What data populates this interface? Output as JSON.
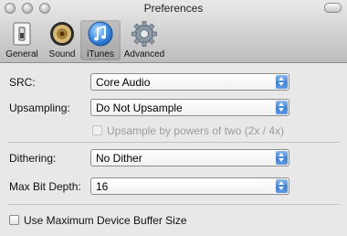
{
  "window": {
    "title": "Preferences"
  },
  "toolbar": {
    "items": [
      {
        "label": "General",
        "icon": "toggle-switch-icon"
      },
      {
        "label": "Sound",
        "icon": "speaker-icon"
      },
      {
        "label": "iTunes",
        "icon": "itunes-icon",
        "selected": true
      },
      {
        "label": "Advanced",
        "icon": "gear-icon"
      }
    ]
  },
  "form": {
    "src": {
      "label": "SRC:",
      "value": "Core Audio"
    },
    "upsampling": {
      "label": "Upsampling:",
      "value": "Do Not Upsample"
    },
    "upsample_pow2": {
      "label": "Upsample by powers of two (2x / 4x)",
      "checked": false,
      "enabled": false
    },
    "dithering": {
      "label": "Dithering:",
      "value": "No Dither"
    },
    "max_bit_depth": {
      "label": "Max Bit Depth:",
      "value": "16"
    },
    "max_buffer": {
      "label": "Use Maximum Device Buffer Size",
      "checked": false
    }
  },
  "colors": {
    "accent": "#3d82dd"
  }
}
